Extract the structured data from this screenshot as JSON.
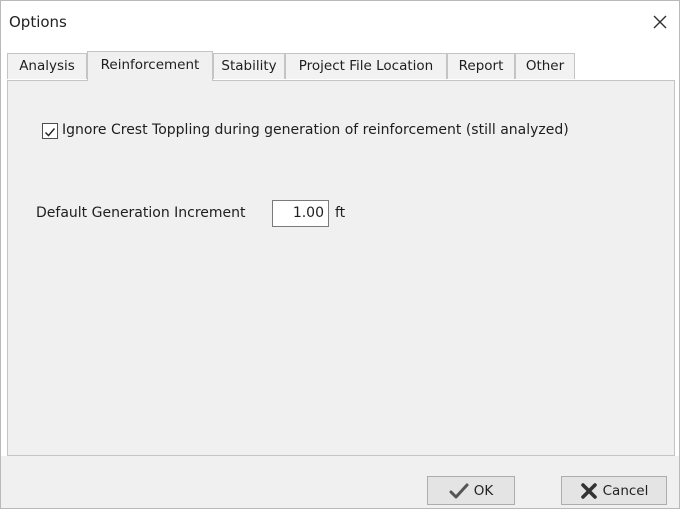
{
  "window": {
    "title": "Options"
  },
  "tabs": [
    {
      "label": "Analysis",
      "active": false
    },
    {
      "label": "Reinforcement",
      "active": true
    },
    {
      "label": "Stability",
      "active": false
    },
    {
      "label": "Project File Location",
      "active": false
    },
    {
      "label": "Report",
      "active": false
    },
    {
      "label": "Other",
      "active": false
    }
  ],
  "reinforcement": {
    "ignore_crest_toppling": {
      "label": "Ignore Crest Toppling during generation of reinforcement (still analyzed)",
      "checked": true
    },
    "generation_increment": {
      "label": "Default Generation Increment",
      "value": "1.00",
      "unit": "ft"
    }
  },
  "buttons": {
    "ok_label": "OK",
    "cancel_label": "Cancel"
  },
  "colors": {
    "panel_bg": "#f0f0f0",
    "ok_icon": "#555555",
    "cancel_icon": "#333333"
  },
  "icons": {
    "close": "close-icon",
    "ok": "checkmark-icon",
    "cancel": "x-icon"
  }
}
